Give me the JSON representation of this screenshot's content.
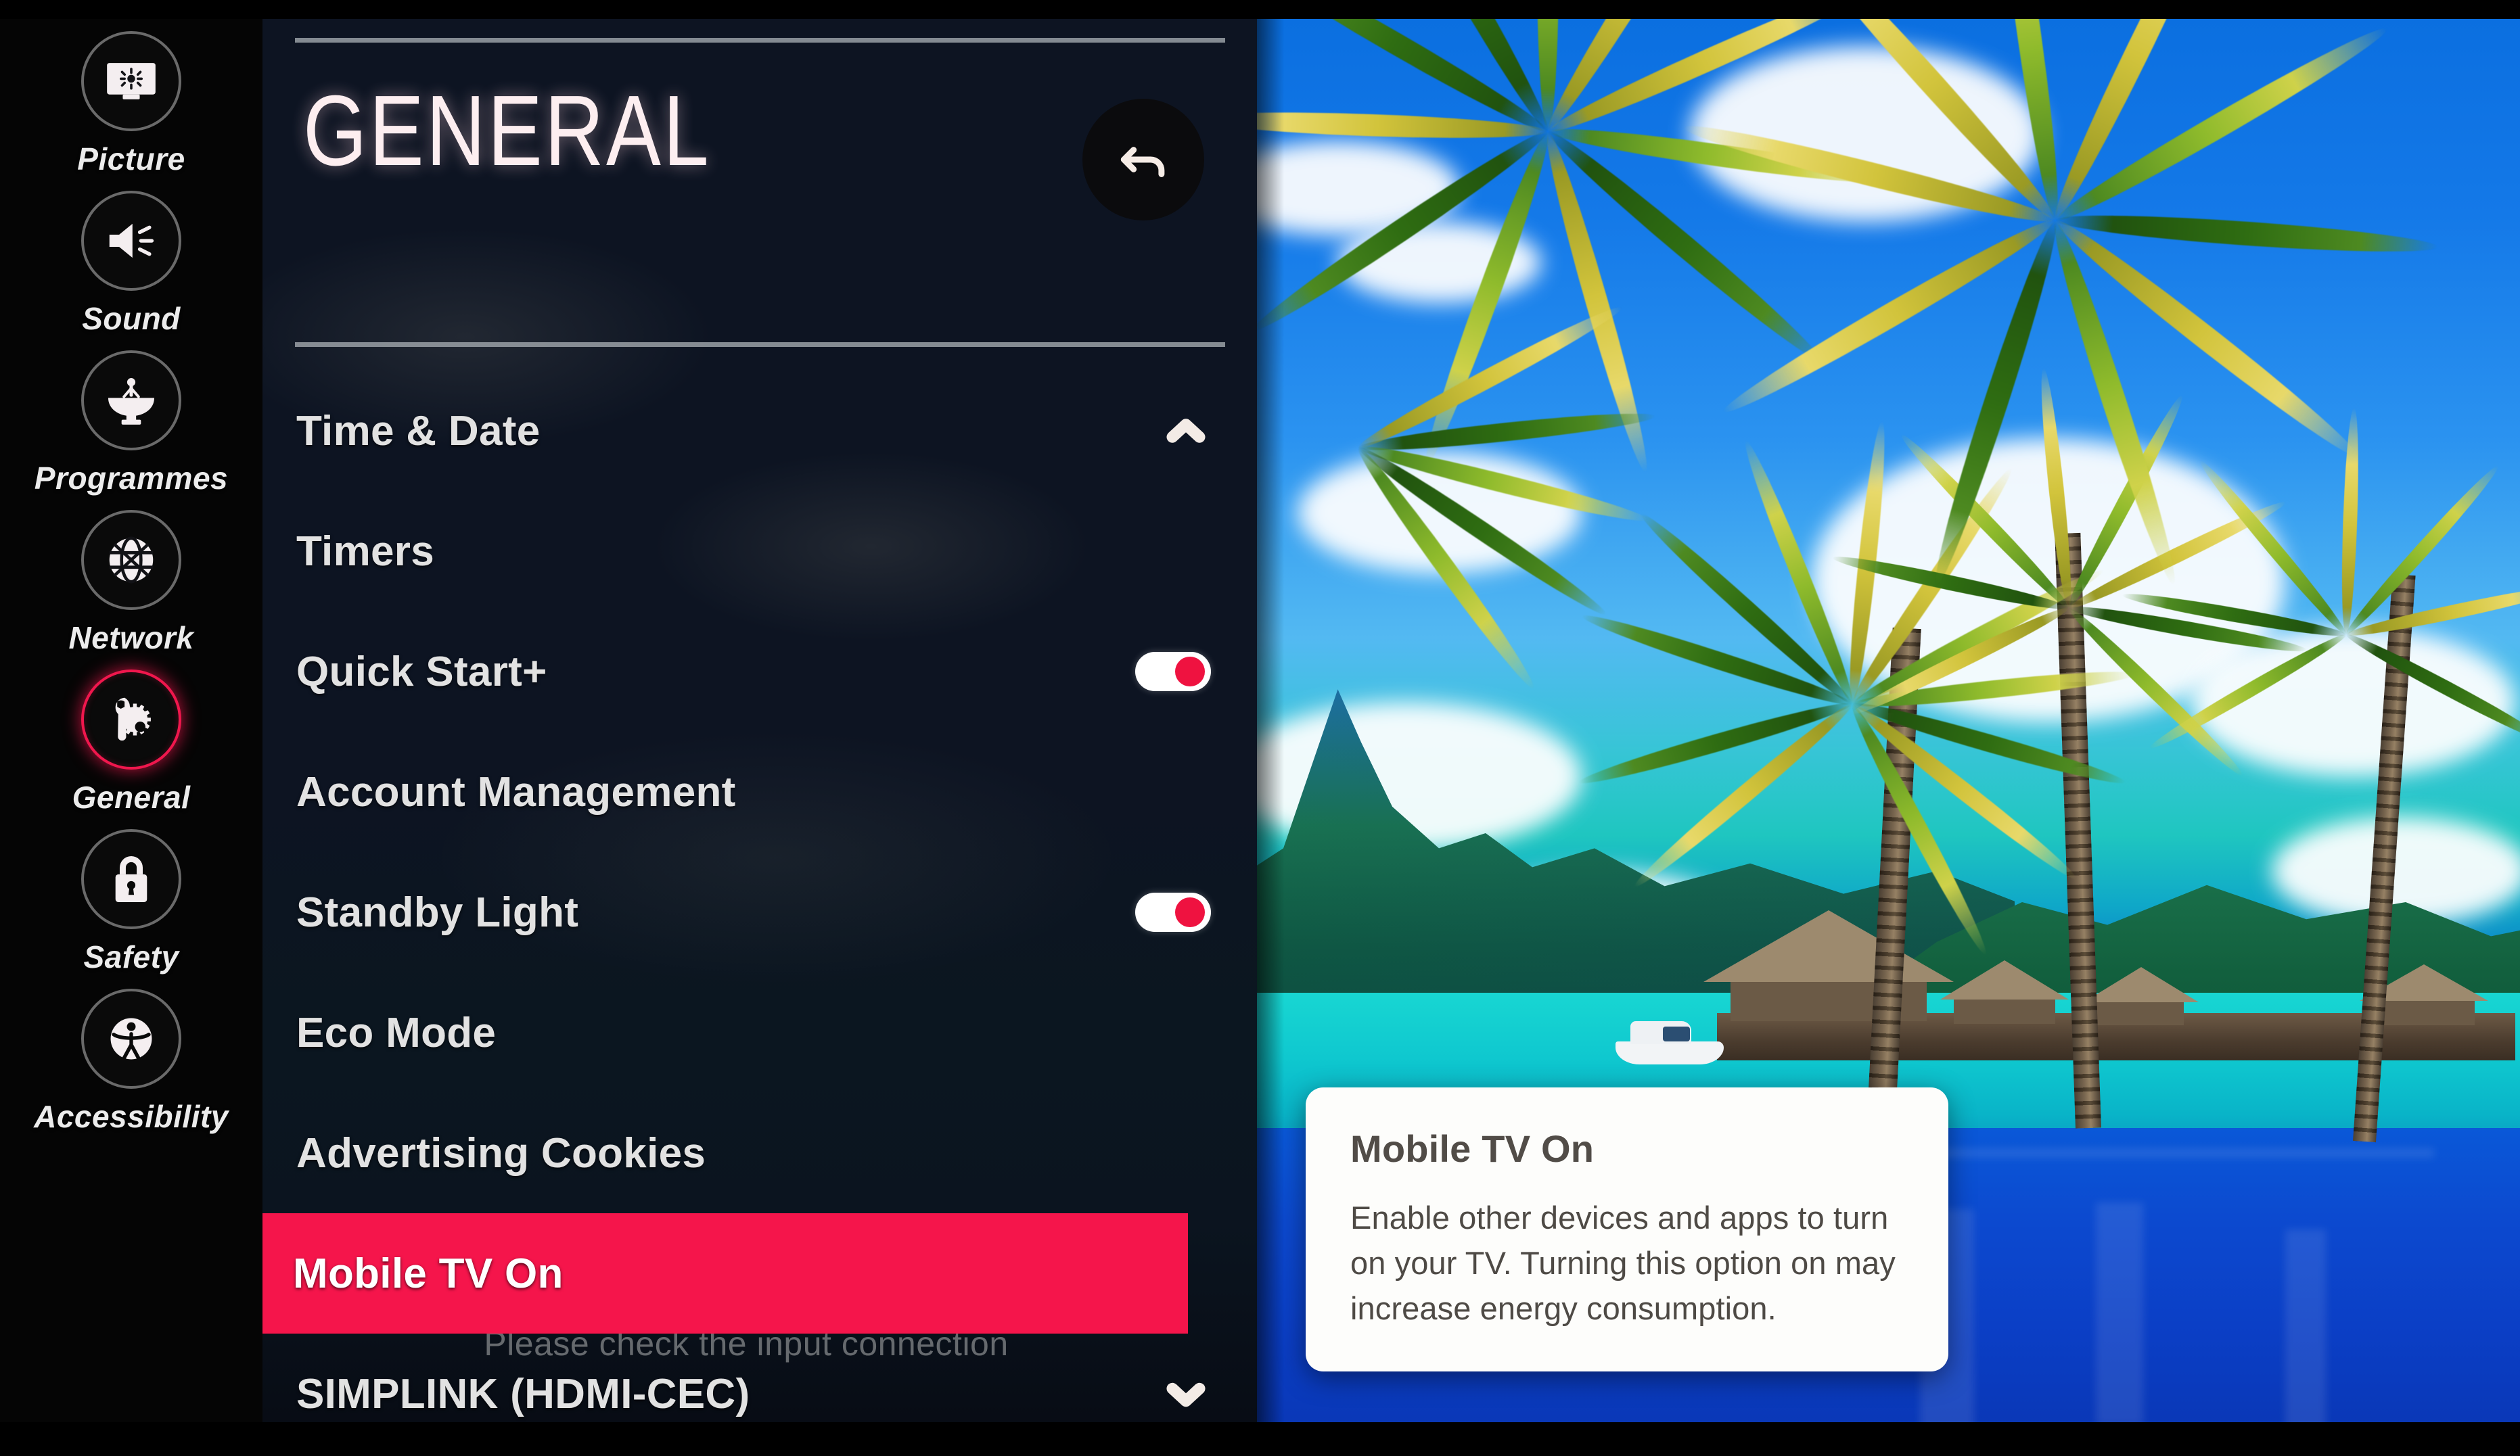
{
  "sidebar": {
    "items": [
      {
        "label": "Picture",
        "icon": "monitor-brightness-icon",
        "active": false
      },
      {
        "label": "Sound",
        "icon": "speaker-icon",
        "active": false
      },
      {
        "label": "Programmes",
        "icon": "satellite-dish-icon",
        "active": false
      },
      {
        "label": "Network",
        "icon": "globe-icon",
        "active": false
      },
      {
        "label": "General",
        "icon": "wrench-gear-icon",
        "active": true
      },
      {
        "label": "Safety",
        "icon": "padlock-icon",
        "active": false
      },
      {
        "label": "Accessibility",
        "icon": "accessibility-icon",
        "active": false
      }
    ]
  },
  "panel": {
    "title": "GENERAL",
    "back_button": "back-arrow-icon",
    "input_status": "Please check the input connection",
    "items": [
      {
        "label": "Time & Date",
        "control": "chevron-up",
        "selected": false
      },
      {
        "label": "Timers",
        "control": "none",
        "selected": false
      },
      {
        "label": "Quick Start+",
        "control": "toggle-on",
        "selected": false
      },
      {
        "label": "Account Management",
        "control": "none",
        "selected": false
      },
      {
        "label": "Standby Light",
        "control": "toggle-on",
        "selected": false
      },
      {
        "label": "Eco Mode",
        "control": "none",
        "selected": false
      },
      {
        "label": "Advertising Cookies",
        "control": "none",
        "selected": false
      },
      {
        "label": "Mobile TV On",
        "control": "none",
        "selected": true
      },
      {
        "label": "SIMPLINK (HDMI-CEC)",
        "control": "chevron-down",
        "selected": false
      }
    ]
  },
  "tooltip": {
    "title": "Mobile TV On",
    "body": "Enable other devices and apps to turn on your TV. Turning this option on may increase energy consumption."
  },
  "colors": {
    "accent_red": "#f5154b",
    "panel_background": "#0e1626",
    "sidebar_background": "#050505",
    "text_primary": "#e2e2e2",
    "tooltip_background": "#fdfdfb",
    "toggle_knob": "#ef1240"
  },
  "background_image": {
    "description": "Tropical lagoon scene with palm trees, blue sky with clouds, green volcanic mountain, thatched overwater bungalows, pier, white boat and reflecting pool"
  }
}
